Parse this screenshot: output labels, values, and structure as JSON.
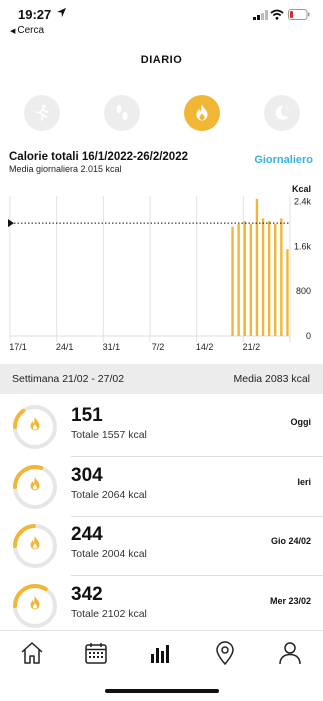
{
  "status": {
    "time": "19:27",
    "back_label": "Cerca"
  },
  "header": {
    "title": "DIARIO"
  },
  "activity_tabs": [
    {
      "name": "running-icon",
      "selected": false
    },
    {
      "name": "steps-icon",
      "selected": false
    },
    {
      "name": "calories-flame-icon",
      "selected": true
    },
    {
      "name": "sleep-moon-icon",
      "selected": false
    }
  ],
  "summary": {
    "title": "Calorie totali 16/1/2022-26/2/2022",
    "subtitle": "Media giornaliera 2.015 kcal",
    "period": "Giornaliero"
  },
  "chart_data": {
    "type": "bar",
    "ylabel": "Kcal",
    "y_ticks": [
      "2.4k",
      "1.6k",
      "800",
      "0"
    ],
    "y_tick_values": [
      2400,
      1600,
      800,
      0
    ],
    "ylim": [
      0,
      2500
    ],
    "x_ticks": [
      "17/1",
      "24/1",
      "31/1",
      "7/2",
      "14/2",
      "21/2"
    ],
    "average_line": 2015,
    "grid": true,
    "x": [
      "17/2",
      "18/2",
      "19/2",
      "20/2",
      "21/2",
      "22/2",
      "23/2",
      "24/2",
      "25/2",
      "26/2"
    ],
    "values": [
      1950,
      2000,
      2050,
      2000,
      2450,
      2100,
      2050,
      2000,
      2100,
      1550
    ],
    "color": "#f2b637"
  },
  "week": {
    "label": "Settimana 21/02 - 27/02",
    "average": "Media 2083 kcal"
  },
  "days": [
    {
      "value": "151",
      "total": "Totale 1557 kcal",
      "day": "Oggi",
      "progress": 0.15
    },
    {
      "value": "304",
      "total": "Totale 2064 kcal",
      "day": "Ieri",
      "progress": 0.3
    },
    {
      "value": "244",
      "total": "Totale 2004 kcal",
      "day": "Gio 24/02",
      "progress": 0.24
    },
    {
      "value": "342",
      "total": "Totale 2102 kcal",
      "day": "Mer 23/02",
      "progress": 0.34
    }
  ],
  "tabbar": [
    "home-icon",
    "calendar-icon",
    "statistics-icon",
    "location-pin-icon",
    "profile-icon"
  ],
  "colors": {
    "accent": "#f2b637",
    "link": "#34b4e0",
    "ring_track": "#e6e6e6"
  }
}
